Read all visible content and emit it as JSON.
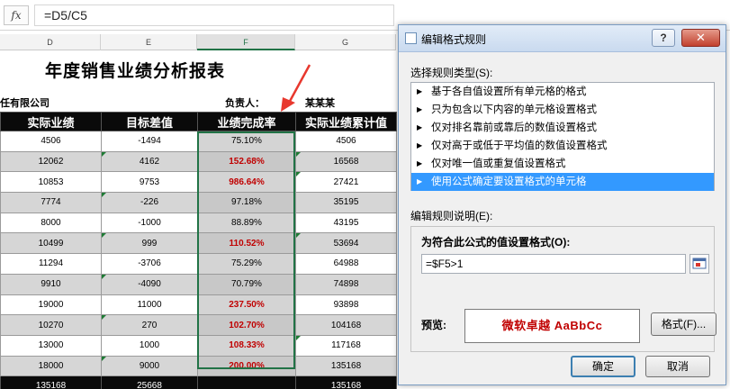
{
  "formula_bar": {
    "fx_label": "fx",
    "formula": "=D5/C5"
  },
  "columns": [
    {
      "letter": "D"
    },
    {
      "letter": "E"
    },
    {
      "letter": "F"
    },
    {
      "letter": "G"
    }
  ],
  "sheet": {
    "title": "年度销售业绩分析报表",
    "company": "任有限公司",
    "responsible_label": "负责人：",
    "responsible_name": "某某某",
    "headers": [
      "实际业绩",
      "目标差值",
      "业绩完成率",
      "实际业绩累计值"
    ],
    "rows": [
      {
        "actual": "4506",
        "diff": "-1494",
        "rate": "75.10%",
        "cum": "4506",
        "hl": false
      },
      {
        "actual": "12062",
        "diff": "4162",
        "rate": "152.68%",
        "cum": "16568",
        "hl": true
      },
      {
        "actual": "10853",
        "diff": "9753",
        "rate": "986.64%",
        "cum": "27421",
        "hl": true
      },
      {
        "actual": "7774",
        "diff": "-226",
        "rate": "97.18%",
        "cum": "35195",
        "hl": false
      },
      {
        "actual": "8000",
        "diff": "-1000",
        "rate": "88.89%",
        "cum": "43195",
        "hl": false
      },
      {
        "actual": "10499",
        "diff": "999",
        "rate": "110.52%",
        "cum": "53694",
        "hl": true
      },
      {
        "actual": "11294",
        "diff": "-3706",
        "rate": "75.29%",
        "cum": "64988",
        "hl": false
      },
      {
        "actual": "9910",
        "diff": "-4090",
        "rate": "70.79%",
        "cum": "74898",
        "hl": false
      },
      {
        "actual": "19000",
        "diff": "11000",
        "rate": "237.50%",
        "cum": "93898",
        "hl": true
      },
      {
        "actual": "10270",
        "diff": "270",
        "rate": "102.70%",
        "cum": "104168",
        "hl": true
      },
      {
        "actual": "13000",
        "diff": "1000",
        "rate": "108.33%",
        "cum": "117168",
        "hl": true
      },
      {
        "actual": "18000",
        "diff": "9000",
        "rate": "200.00%",
        "cum": "135168",
        "hl": true
      }
    ],
    "totals": {
      "actual": "135168",
      "diff": "25668",
      "rate": "",
      "cum": "135168"
    }
  },
  "dialog": {
    "title": "编辑格式规则",
    "help_label": "?",
    "close_label": "✕",
    "rule_type_label": "选择规则类型(S):",
    "rule_types": [
      "基于各自值设置所有单元格的格式",
      "只为包含以下内容的单元格设置格式",
      "仅对排名靠前或靠后的数值设置格式",
      "仅对高于或低于平均值的数值设置格式",
      "仅对唯一值或重复值设置格式",
      "使用公式确定要设置格式的单元格"
    ],
    "selected_rule_index": 5,
    "rule_desc_label": "编辑规则说明(E):",
    "formula_caption": "为符合此公式的值设置格式(O):",
    "formula_value": "=$F5>1",
    "preview_label": "预览:",
    "preview_text": "微软卓越  AaBbCc",
    "format_button": "格式(F)...",
    "ok_button": "确定",
    "cancel_button": "取消"
  },
  "colors": {
    "highlight_text": "#c00000",
    "header_bg": "#0a0a0a",
    "selected_rule_bg": "#3399ff",
    "arrow": "#e8382e",
    "selection_border": "#217346"
  }
}
